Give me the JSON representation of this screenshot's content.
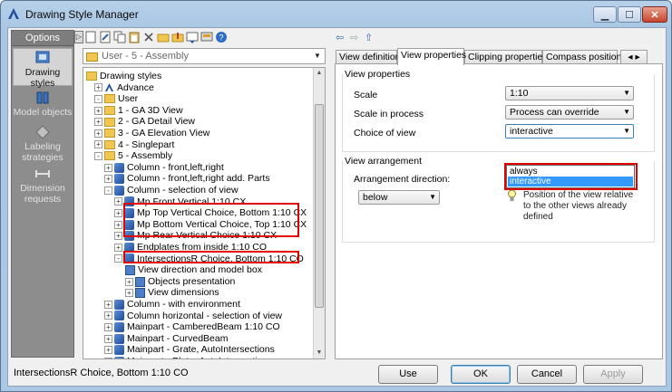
{
  "window": {
    "title": "Drawing Style Manager",
    "minimize": "▁",
    "maximize": "☐",
    "close": "✕"
  },
  "left_panel": {
    "header": "Options",
    "collapse": "▷",
    "items": [
      {
        "label": "Drawing styles",
        "icon": "drawing-styles-icon"
      },
      {
        "label": "Model objects",
        "icon": "model-objects-icon"
      },
      {
        "label": "Labeling strategies",
        "icon": "labeling-icon"
      },
      {
        "label": "Dimension requests",
        "icon": "dimension-icon"
      }
    ]
  },
  "style_combo": {
    "value": "User - 5 - Assembly"
  },
  "tree": {
    "rows": [
      {
        "text": "Drawing styles",
        "level": 0,
        "exp": "",
        "icon": "folder"
      },
      {
        "text": "Advance",
        "level": 1,
        "exp": "+",
        "icon": "advance"
      },
      {
        "text": "User",
        "level": 1,
        "exp": "-",
        "icon": "folder"
      },
      {
        "text": "1 - GA 3D View",
        "level": 2,
        "exp": "+",
        "icon": "folder"
      },
      {
        "text": "2 - GA Detail View",
        "level": 2,
        "exp": "+",
        "icon": "folder"
      },
      {
        "text": "3 - GA Elevation View",
        "level": 2,
        "exp": "+",
        "icon": "folder"
      },
      {
        "text": "4 - Singlepart",
        "level": 2,
        "exp": "+",
        "icon": "folder"
      },
      {
        "text": "5 - Assembly",
        "level": 2,
        "exp": "-",
        "icon": "folder"
      },
      {
        "text": "Column - front,left,right",
        "level": 3,
        "exp": "+",
        "icon": "view"
      },
      {
        "text": "Column - front,left,right add. Parts",
        "level": 3,
        "exp": "+",
        "icon": "view"
      },
      {
        "text": "Column - selection of view",
        "level": 3,
        "exp": "-",
        "icon": "view"
      },
      {
        "text": "Mp Front Vertical 1:10 CX",
        "level": 4,
        "exp": "+",
        "icon": "view"
      },
      {
        "text": "Mp Top Vertical Choice, Bottom 1:10 CX",
        "level": 4,
        "exp": "+",
        "icon": "view"
      },
      {
        "text": "Mp Bottom Vertical Choice, Top 1:10 CX",
        "level": 4,
        "exp": "+",
        "icon": "view"
      },
      {
        "text": "Mp Rear Vertical Choice 1:10 CX",
        "level": 4,
        "exp": "+",
        "icon": "view"
      },
      {
        "text": "Endplates from inside 1:10 CO",
        "level": 4,
        "exp": "+",
        "icon": "view"
      },
      {
        "text": "IntersectionsR Choice, Bottom 1:10 CO",
        "level": 4,
        "exp": "-",
        "icon": "view"
      },
      {
        "text": "View direction and model box",
        "level": 5,
        "exp": "",
        "icon": "doc"
      },
      {
        "text": "Objects presentation",
        "level": 5,
        "exp": "+",
        "icon": "doc"
      },
      {
        "text": "View dimensions",
        "level": 5,
        "exp": "+",
        "icon": "doc"
      },
      {
        "text": "Column - with environment",
        "level": 3,
        "exp": "+",
        "icon": "view"
      },
      {
        "text": "Column horizontal - selection of view",
        "level": 3,
        "exp": "+",
        "icon": "view"
      },
      {
        "text": "Mainpart - CamberedBeam 1:10 CO",
        "level": 3,
        "exp": "+",
        "icon": "view"
      },
      {
        "text": "Mainpart - CurvedBeam",
        "level": 3,
        "exp": "+",
        "icon": "view"
      },
      {
        "text": "Mainpart - Grate, AutoIntersections",
        "level": 3,
        "exp": "+",
        "icon": "view"
      },
      {
        "text": "Mainpart - Plate, AutoIntersections",
        "level": 3,
        "exp": "+",
        "icon": "view"
      }
    ]
  },
  "tabs": [
    "View definition",
    "View properties",
    "Clipping properties",
    "Compass position"
  ],
  "tab_scroll": "◂ ▸",
  "view_properties": {
    "group": "View properties",
    "scale_label": "Scale",
    "scale_value": "1:10",
    "scale_process_label": "Scale in process",
    "scale_process_value": "Process can override",
    "choice_label": "Choice of view",
    "choice_value": "interactive",
    "options": [
      "always",
      "interactive"
    ]
  },
  "view_arrangement": {
    "group": "View arrangement",
    "direction_label": "Arrangement direction:",
    "direction_value": "below",
    "hint": "Position of the view relative to the other views already defined"
  },
  "status": "IntersectionsR Choice, Bottom 1:10 CO",
  "buttons": {
    "use": "Use",
    "ok": "OK",
    "cancel": "Cancel",
    "apply": "Apply"
  },
  "colors": {
    "highlight": "#e30000",
    "selection": "#3399ff"
  }
}
